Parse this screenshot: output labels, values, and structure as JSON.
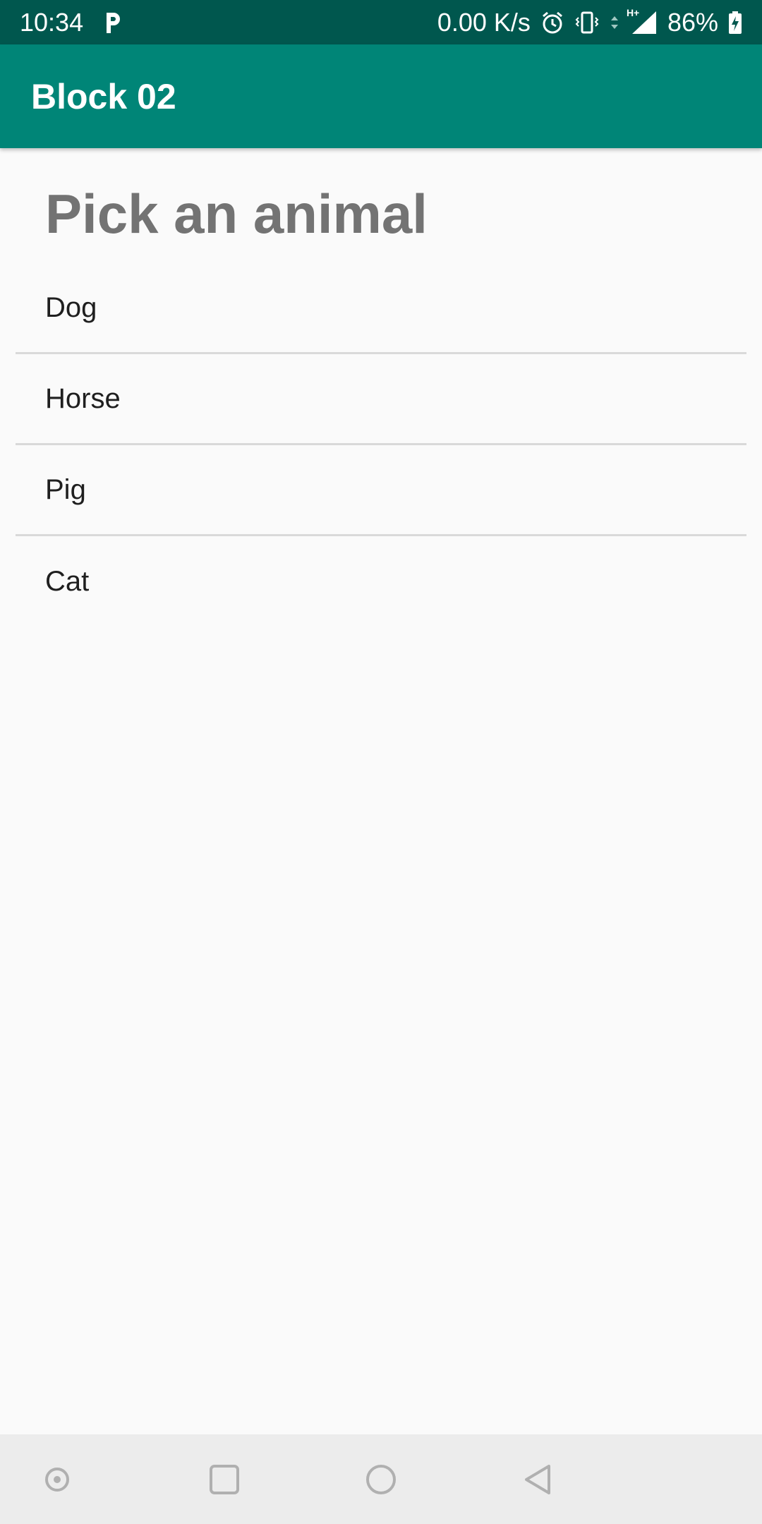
{
  "status_bar": {
    "time": "10:34",
    "network_speed": "0.00 K/s",
    "network_type": "H+",
    "battery": "86%",
    "icons": [
      "parking-icon",
      "alarm-icon",
      "vibrate-icon",
      "data-arrows-icon",
      "signal-icon",
      "battery-charging-icon"
    ]
  },
  "app_bar": {
    "title": "Block 02"
  },
  "main": {
    "heading": "Pick an animal",
    "items": [
      {
        "label": "Dog"
      },
      {
        "label": "Horse"
      },
      {
        "label": "Pig"
      },
      {
        "label": "Cat"
      }
    ]
  },
  "nav_bar": {
    "icons": [
      "assistant-icon",
      "recents-icon",
      "home-icon",
      "back-icon"
    ]
  },
  "colors": {
    "status_bar": "#00574e",
    "app_bar": "#008577",
    "background": "#fafafa",
    "heading": "#737373",
    "divider": "#d9d9d9",
    "nav_bar": "#ececec",
    "nav_icons": "#b0b0b0"
  }
}
